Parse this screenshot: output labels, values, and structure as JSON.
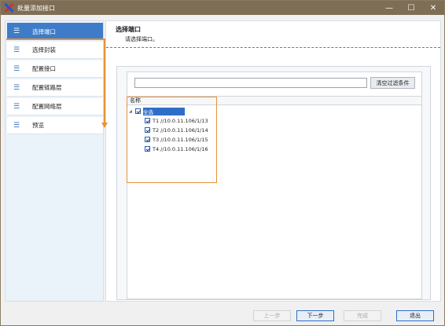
{
  "window": {
    "title": "批量添加接口",
    "controls": {
      "minimize": "—",
      "maximize": "☐",
      "close": "✕"
    }
  },
  "sidebar": {
    "items": [
      {
        "label": "选择端口",
        "active": true
      },
      {
        "label": "选择封装",
        "active": false
      },
      {
        "label": "配置接口",
        "active": false
      },
      {
        "label": "配置链路层",
        "active": false
      },
      {
        "label": "配置网络层",
        "active": false
      },
      {
        "label": "预览",
        "active": false
      }
    ]
  },
  "main": {
    "title": "选择端口",
    "subtitle": "请选择端口。",
    "filter": {
      "value": "",
      "placeholder": ""
    },
    "clear_button": "清空过滤条件",
    "column_header": "名称",
    "tree": {
      "root": {
        "label": "全选",
        "checked": true,
        "expanded": true
      },
      "ports": [
        {
          "label": "T1 //10.0.11.106/1/13",
          "checked": true
        },
        {
          "label": "T2 //10.0.11.106/1/14",
          "checked": true
        },
        {
          "label": "T3 //10.0.11.106/1/15",
          "checked": true
        },
        {
          "label": "T4 //10.0.11.106/1/16",
          "checked": true
        }
      ]
    }
  },
  "footer": {
    "prev": "上一步",
    "next": "下一步",
    "finish": "完成",
    "exit": "退出"
  },
  "colors": {
    "titlebar": "#7d6e55",
    "accent": "#3e7cc9",
    "annotation": "#e8923a"
  }
}
